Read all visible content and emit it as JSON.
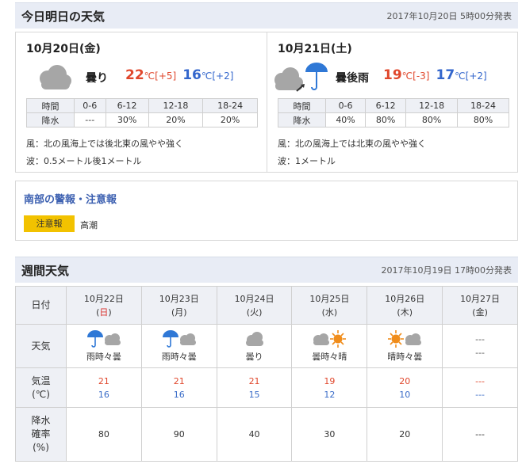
{
  "today": {
    "title": "今日明日の天気",
    "issued": "2017年10月20日 5時00分発表",
    "days": [
      {
        "date": "10月20日(金)",
        "weather": "曇り",
        "icon": "cloud-icon",
        "high": "22",
        "high_diff": "[+5]",
        "low": "16",
        "low_diff": "[+2]",
        "unit": "℃",
        "table_head": [
          "時間",
          "0-6",
          "6-12",
          "12-18",
          "18-24"
        ],
        "table_row": [
          "降水",
          "---",
          "30%",
          "20%",
          "20%"
        ],
        "wind": "風：北の風海上では後北東の風やや強く",
        "wave": "波：0.5メートル後1メートル"
      },
      {
        "date": "10月21日(土)",
        "weather": "曇後雨",
        "icon": "cloud-then-rain-icon",
        "high": "19",
        "high_diff": "[-3]",
        "low": "17",
        "low_diff": "[+2]",
        "unit": "℃",
        "table_head": [
          "時間",
          "0-6",
          "6-12",
          "12-18",
          "18-24"
        ],
        "table_row": [
          "降水",
          "40%",
          "80%",
          "80%",
          "80%"
        ],
        "wind": "風：北の風海上では北東の風やや強く",
        "wave": "波：1メートル"
      }
    ]
  },
  "alerts": {
    "title": "南部の警報・注意報",
    "badge": "注意報",
    "item": "高潮"
  },
  "weekly": {
    "title": "週間天気",
    "issued": "2017年10月19日 17時00分発表",
    "row_labels": {
      "date": "日付",
      "weather": "天気",
      "temp": [
        "気温",
        "(℃)"
      ],
      "pop": [
        "降水",
        "確率",
        "(%)"
      ]
    },
    "days": [
      {
        "date": "10月22日",
        "dow": "日",
        "weather": "雨時々曇",
        "icon": "rain-sometimes-cloud-icon",
        "high": "21",
        "low": "16",
        "pop": "80"
      },
      {
        "date": "10月23日",
        "dow": "月",
        "weather": "雨時々曇",
        "icon": "rain-sometimes-cloud-icon",
        "high": "21",
        "low": "16",
        "pop": "90"
      },
      {
        "date": "10月24日",
        "dow": "火",
        "weather": "曇り",
        "icon": "cloud-icon",
        "high": "21",
        "low": "15",
        "pop": "40"
      },
      {
        "date": "10月25日",
        "dow": "水",
        "weather": "曇時々晴",
        "icon": "cloud-sometimes-sun-icon",
        "high": "19",
        "low": "12",
        "pop": "30"
      },
      {
        "date": "10月26日",
        "dow": "木",
        "weather": "晴時々曇",
        "icon": "sun-sometimes-cloud-icon",
        "high": "20",
        "low": "10",
        "pop": "20"
      },
      {
        "date": "10月27日",
        "dow": "金",
        "weather": "---",
        "weather2": "---",
        "icon": "",
        "high": "---",
        "low": "---",
        "pop": "---"
      }
    ]
  },
  "colors": {
    "header_bg": "#e8ecf5",
    "high_temp": "#e0472c",
    "low_temp": "#3366cc",
    "alert_badge": "#f2c200",
    "link_blue": "#3b5fb0",
    "sunday_red": "#d9302c",
    "umbrella_blue": "#2f78d6",
    "sun_orange": "#f08c1a"
  }
}
